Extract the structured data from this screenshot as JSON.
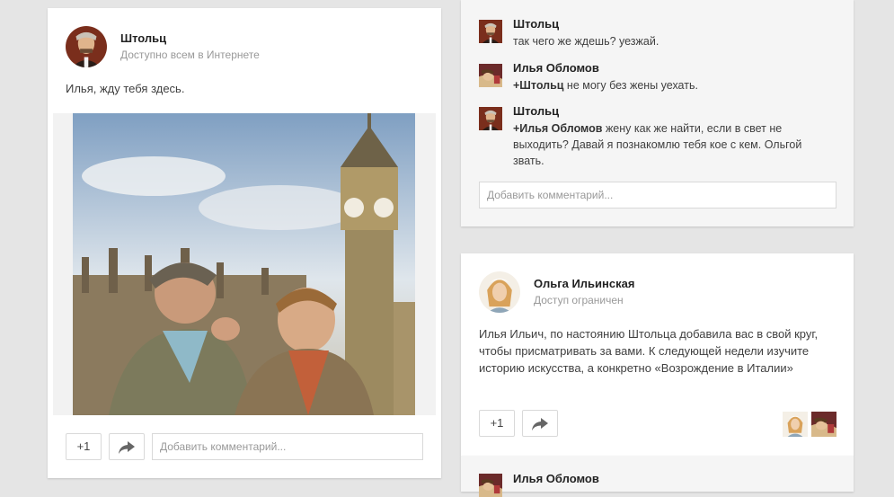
{
  "post1": {
    "author": "Штольц",
    "visibility": "Доступно всем в Интернете",
    "text": "Илья, жду тебя здесь.",
    "plus_label": "+1",
    "comment_placeholder": "Добавить комментарий..."
  },
  "comments_block": {
    "comments": [
      {
        "author": "Штольц",
        "text": "так чего же ждешь? уезжай."
      },
      {
        "author": "Илья Обломов",
        "mention": "+Штольц",
        "text": " не могу без жены уехать."
      },
      {
        "author": "Штольц",
        "mention": "+Илья Обломов",
        "text_line1": " жену как же найти, если в свет не",
        "text_line2": "выходить? Давай я познакомлю тебя кое с кем. Ольгой",
        "text_line3": "звать."
      }
    ],
    "comment_placeholder": "Добавить комментарий..."
  },
  "post2": {
    "author": "Ольга Ильинская",
    "visibility": "Доступ ограничен",
    "text_line1": "Илья Ильич, по настоянию Штольца добавила вас в свой круг,",
    "text_line2": "чтобы присматривать за вами. К следующей недели изучите",
    "text_line3": "историю искусства, а конкретно «Возрождение в Италии»",
    "plus_label": "+1"
  },
  "post3": {
    "author": "Илья Обломов"
  },
  "icons": {
    "share": "share-arrow-icon"
  }
}
